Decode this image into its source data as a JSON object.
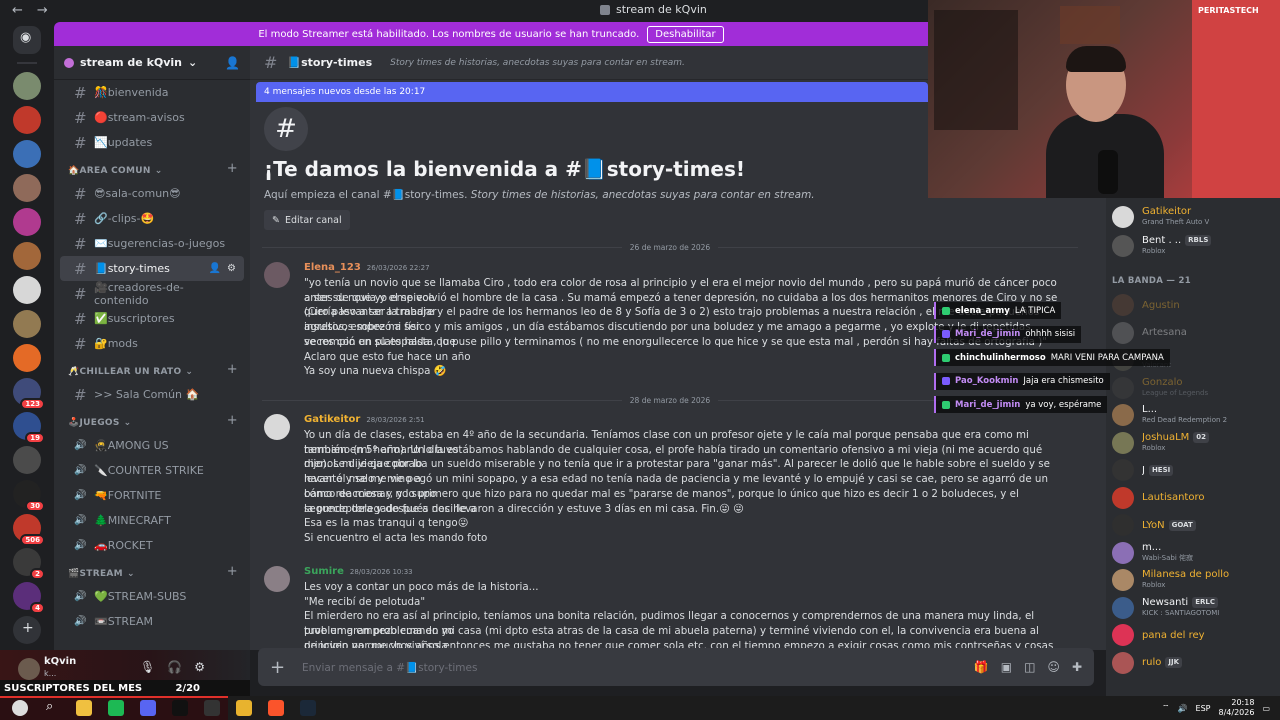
{
  "window": {
    "title": "stream de kQvin"
  },
  "banner": {
    "text": "El modo Streamer está habilitado. Los nombres de usuario se han truncado.",
    "button": "Deshabilitar"
  },
  "guild": {
    "name": "stream de kQvin"
  },
  "server_rail": [
    {
      "icon": "discord-home-icon",
      "color": "#313338"
    },
    {
      "icon": "server-avatar",
      "color": "#7a8b6e"
    },
    {
      "icon": "server-avatar",
      "color": "#c0392b"
    },
    {
      "icon": "server-avatar",
      "color": "#3b6fb6"
    },
    {
      "icon": "server-avatar",
      "color": "#8f6a5a"
    },
    {
      "icon": "server-avatar",
      "color": "#b03a8f"
    },
    {
      "icon": "server-avatar",
      "color": "#a2673a"
    },
    {
      "icon": "server-avatar",
      "color": "#d7d7d7"
    },
    {
      "icon": "server-avatar",
      "color": "#927a52"
    },
    {
      "icon": "server-avatar",
      "color": "#e46a26"
    },
    {
      "icon": "server-avatar",
      "color": "#3f4b7a",
      "badge": "123"
    },
    {
      "icon": "server-avatar",
      "color": "#2f4f90",
      "badge": "19"
    },
    {
      "icon": "server-avatar",
      "color": "#4b4b4b"
    },
    {
      "icon": "server-avatar",
      "color": "#222",
      "badge": "30"
    },
    {
      "icon": "server-avatar",
      "color": "#c0392b",
      "badge": "506"
    },
    {
      "icon": "server-avatar",
      "color": "#3a3a3a",
      "badge": "2"
    },
    {
      "icon": "server-avatar",
      "color": "#5b2e7a",
      "badge": "4"
    },
    {
      "icon": "add-server-icon",
      "color": "#313338"
    },
    {
      "icon": "explore-icon",
      "color": "#313338"
    }
  ],
  "channels": [
    {
      "type": "channel",
      "label": "🎊bienvenida"
    },
    {
      "type": "channel",
      "label": "🔴stream-avisos"
    },
    {
      "type": "channel",
      "label": "📉updates"
    },
    {
      "type": "category",
      "label": "🏠AREA COMUN"
    },
    {
      "type": "channel",
      "label": "😎sala-comun😎"
    },
    {
      "type": "channel",
      "label": "🔗-clips-🤩"
    },
    {
      "type": "channel",
      "label": "✉️sugerencias-o-juegos"
    },
    {
      "type": "channel",
      "label": "📘story-times",
      "active": true
    },
    {
      "type": "channel",
      "label": "🎥creadores-de-contenido"
    },
    {
      "type": "channel",
      "label": "✅suscriptores"
    },
    {
      "type": "channel",
      "label": "🔐mods"
    },
    {
      "type": "category",
      "label": "🥂CHILLEAR UN RATO"
    },
    {
      "type": "channel",
      "label": ">> Sala Común 🏠"
    },
    {
      "type": "category",
      "label": "🕹️JUEGOS"
    },
    {
      "type": "voice",
      "label": "🥷AMONG US"
    },
    {
      "type": "voice",
      "label": "🔪COUNTER STRIKE"
    },
    {
      "type": "voice",
      "label": "🔫FORTNITE"
    },
    {
      "type": "voice",
      "label": "🌲MINECRAFT"
    },
    {
      "type": "voice",
      "label": "🚗ROCKET"
    },
    {
      "type": "category",
      "label": "🎬STREAM"
    },
    {
      "type": "voice",
      "label": "💚STREAM-SUBS"
    },
    {
      "type": "voice",
      "label": "📼STREAM"
    }
  ],
  "user": {
    "name": "kQvin",
    "status": "k..."
  },
  "subs": {
    "label": "SUSCRIPTORES DEL MES",
    "count": "2/20"
  },
  "channel": {
    "name": "📘story-times",
    "topic": "Story times de historias, anecdotas suyas para contar en stream."
  },
  "new_messages": "4 mensajes nuevos desde las 20:17",
  "welcome": {
    "title": "¡Te damos la bienvenida a #📘story-times!",
    "sub_prefix": "Aquí empieza el canal #📘story-times. ",
    "sub_topic": "Story times de historias, anecdotas suyas para contar en stream.",
    "edit": "Editar canal"
  },
  "dividers": [
    "26 de marzo de 2026",
    "28 de marzo de 2026"
  ],
  "messages": [
    {
      "author": "Elena_123",
      "time": "26/03/2026 22:27",
      "color": "#e8905a",
      "avatar": "#6c5a63",
      "lines": [
        "\"yo tenía un novio que se llamaba Ciro , todo era color de rosa al principio y el era el mejor novio del mundo , pero su papá murió de cáncer poco antes de que yo empiece",
        "a ser su novia y el se volvió el hombre de la casa . Su mamá empezó a tener depresión, no cuidaba a los dos hermanitos menores de Ciro y no se quería levantar a trabajar",
        "(Ciro paso a ser la madre y el padre de los hermanos leo de 8 y Sofía de 3 o 2)  esto trajo problemas a nuestra relación , el me decía pequeños insultos, empezó a ser",
        "agresivos sobre mi físico y mis amigos , un día estábamos discutiendo por una boludez y me amago a pegarme , yo explote y le di repetidas veces con un plato hasta que",
        "se rompió en su espalda , lo puse pillo y terminamos ( no me enorgullecerce lo que hice y se que esta mal , perdón si hay faltas de ortografía )\"",
        "Aclaro que esto fue hace un año",
        "Ya soy una nueva chispa 🤣"
      ]
    },
    {
      "author": "Gatikeitor",
      "time": "28/03/2026 2:51",
      "color": "#f0b232",
      "avatar": "#d9d9d9",
      "lines": [
        "Yo un día de clases, estaba en 4º año de la secundaria. Teníamos clase con un profesor ojete y le caía mal porque pensaba que era como mi hermano (mi hermano lo tuvo",
        "también en 5º año). Un día estábamos hablando de cualquier cosa, el profe había tirado un comentario ofensivo a mi vieja (ni me acuerdo qué dijo). Le dije que por lo",
        "menos mi vieja cobraba un sueldo miserable y no tenía que ir a protestar para \"ganar más\". Al parecer le dolió que le hable sobre el sueldo y se levantó y se me vino a",
        "hacer el malo y me pegó un mini sopapo, y a esa edad no tenía nada de paciencia y me levanté y lo empujé y casi se cae, pero se agarró de un banco de mesa y no supo",
        "cómo reaccionar, y lo primero que hizo para no quedar mal es \"pararse de manos\", porque lo único que hizo es decir 1 o 2 boludeces, y el segundo delegado fue a decirle a",
        "la preceptora y después nos llevaron a dirección y estuve 3 días en mi casa. Fin.😜 😜",
        "Esa es la mas tranqui q tengo😜",
        "Si encuentro el acta les mando foto"
      ]
    },
    {
      "author": "Sumire",
      "time": "28/03/2026 10:33",
      "color": "#3ba55c",
      "avatar": "#8a7f86",
      "lines": [
        "Les voy a contar un poco más de la historia...",
        "\"Me recibí de pelotuda\"",
        "El mierdero no era así al principio, teníamos una bonita relación, pudimos llegar a conocernos y comprendernos de una manera muy linda, el problema empezo cuando yo",
        "tuve un gran problema en mi casa (mi dpto esta atras de la casa de mi abuela paterna) y  terminé viviendo con el, la convivencia era buena al principio ya que yo viví sola",
        "de joven por muchos años entonces me gustaba no tener que comer sola etc. con el tiempo empezo a exigir cosas como mis contrseñas y cosas así. joven y boluda se las"
      ]
    }
  ],
  "composer": {
    "placeholder": "Enviar mensaje a #📘story-times"
  },
  "members_top": [
    {
      "name": "Gatikeitor",
      "activity": "Grand Theft Auto V",
      "color": "#f0b232",
      "avatar": "#d9d9d9"
    },
    {
      "name": "Bent . ..",
      "tag": "RBLS",
      "activity": "Roblox",
      "color": "#f2f3f5",
      "avatar": "#555"
    }
  ],
  "members_category": "LA BANDA — 21",
  "members": [
    {
      "name": "Agustin",
      "activity": "",
      "color": "#f0b232",
      "avatar": "#6e4d3a",
      "dim": true
    },
    {
      "name": "Artesana",
      "activity": "",
      "color": "#f2f3f5",
      "avatar": "#888",
      "dim": true
    },
    {
      "name": "_",
      "activity": "Valorant",
      "color": "#f2f3f5",
      "avatar": "#665",
      "dim": true
    },
    {
      "name": "Gonzalo",
      "activity": "League of Legends",
      "color": "#f0b232",
      "avatar": "#444",
      "dim": true
    },
    {
      "name": "L...",
      "activity": "Red Dead Redemption 2",
      "color": "#f2f3f5",
      "avatar": "#8a6a4a"
    },
    {
      "name": "JoshuaLM",
      "tag": "02",
      "activity": "Roblox",
      "color": "#f0b232",
      "avatar": "#775"
    },
    {
      "name": "J",
      "tag": "HESI",
      "activity": "",
      "color": "#f2f3f5",
      "avatar": "#333"
    },
    {
      "name": "Lautisantoro",
      "activity": "",
      "color": "#f0b232",
      "avatar": "#c0392b"
    },
    {
      "name": "LYoN",
      "tag": "GOAT",
      "activity": "",
      "color": "#f0b232",
      "avatar": "#2f2f2f"
    },
    {
      "name": "m...",
      "activity": "Wabi-Sabi 侘寂",
      "color": "#f2f3f5",
      "avatar": "#8b6fb5"
    },
    {
      "name": "Milanesa de pollo",
      "activity": "Roblox",
      "color": "#f0b232",
      "avatar": "#a86"
    },
    {
      "name": "Newsanti",
      "tag": "ERLC",
      "activity": "KICK : SANTIAGOTOMI",
      "color": "#f2f3f5",
      "avatar": "#3b5c8a"
    },
    {
      "name": "pana del rey",
      "activity": "",
      "color": "#f0b232",
      "avatar": "#d35"
    },
    {
      "name": "rulo",
      "tag": "JJK",
      "activity": "",
      "color": "#f0b232",
      "avatar": "#a55"
    }
  ],
  "overlay": [
    {
      "who": "elena_army",
      "text": "LA TIPICA",
      "color": "#ffffff"
    },
    {
      "who": "Mari_de_jimin",
      "text": "ohhhh sisisi",
      "color": "#c38cf5"
    },
    {
      "who": "chinchulinhermoso",
      "text": "MARI VENI PARA CAMPANA",
      "color": "#ffffff"
    },
    {
      "who": "Pao_Kookmin",
      "text": "Jaja era chismesito",
      "color": "#c38cf5"
    },
    {
      "who": "Mari_de_jimin",
      "text": "ya voy, espérame",
      "color": "#c38cf5"
    }
  ],
  "webcam": {
    "poster_text": "PERITASTECH"
  },
  "tray": {
    "lang": "ESP",
    "time": "20:18",
    "date": "8/4/2026"
  },
  "taskbar": [
    {
      "icon": "weather-icon",
      "color": "#ddd"
    },
    {
      "icon": "search-icon",
      "color": "#fff"
    },
    {
      "icon": "files-icon",
      "color": "#f0c040"
    },
    {
      "icon": "spotify-icon",
      "color": "#1db954"
    },
    {
      "icon": "discord-icon",
      "color": "#5865f2"
    },
    {
      "icon": "tiktok-icon",
      "color": "#111"
    },
    {
      "icon": "obs-icon",
      "color": "#333"
    },
    {
      "icon": "chrome-icon",
      "color": "#e8b32e"
    },
    {
      "icon": "brave-icon",
      "color": "#fb542b"
    },
    {
      "icon": "steam-icon",
      "color": "#1b2838"
    }
  ]
}
